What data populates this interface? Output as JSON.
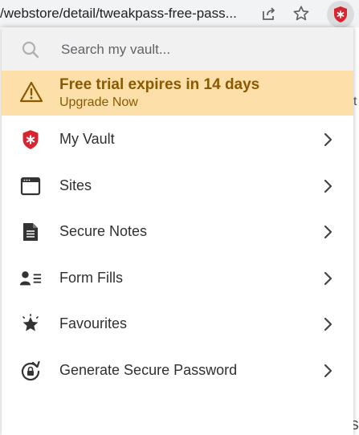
{
  "browser": {
    "url": "/webstore/detail/tweakpass-free-pass...",
    "share_icon": "share-icon",
    "star_icon": "star-icon",
    "extension_icon": "tweakpass-extension-icon"
  },
  "background_page": {
    "edge_letter_top": "t",
    "edge_letter_bottom": "S"
  },
  "popup": {
    "search": {
      "placeholder": "Search my vault...",
      "icon": "search-icon"
    },
    "trial_banner": {
      "title": "Free trial expires in 14 days",
      "link": "Upgrade Now",
      "icon": "warning-icon",
      "background_color": "#fddfa9",
      "text_color": "#8a5a00"
    },
    "menu": [
      {
        "label": "My Vault",
        "icon": "shield-icon"
      },
      {
        "label": "Sites",
        "icon": "browser-window-icon"
      },
      {
        "label": "Secure Notes",
        "icon": "document-icon"
      },
      {
        "label": "Form Fills",
        "icon": "user-card-icon"
      },
      {
        "label": "Favourites",
        "icon": "star-badge-icon"
      },
      {
        "label": "Generate Secure Password",
        "icon": "refresh-lock-icon"
      }
    ],
    "accent_color": "#d9232e"
  }
}
